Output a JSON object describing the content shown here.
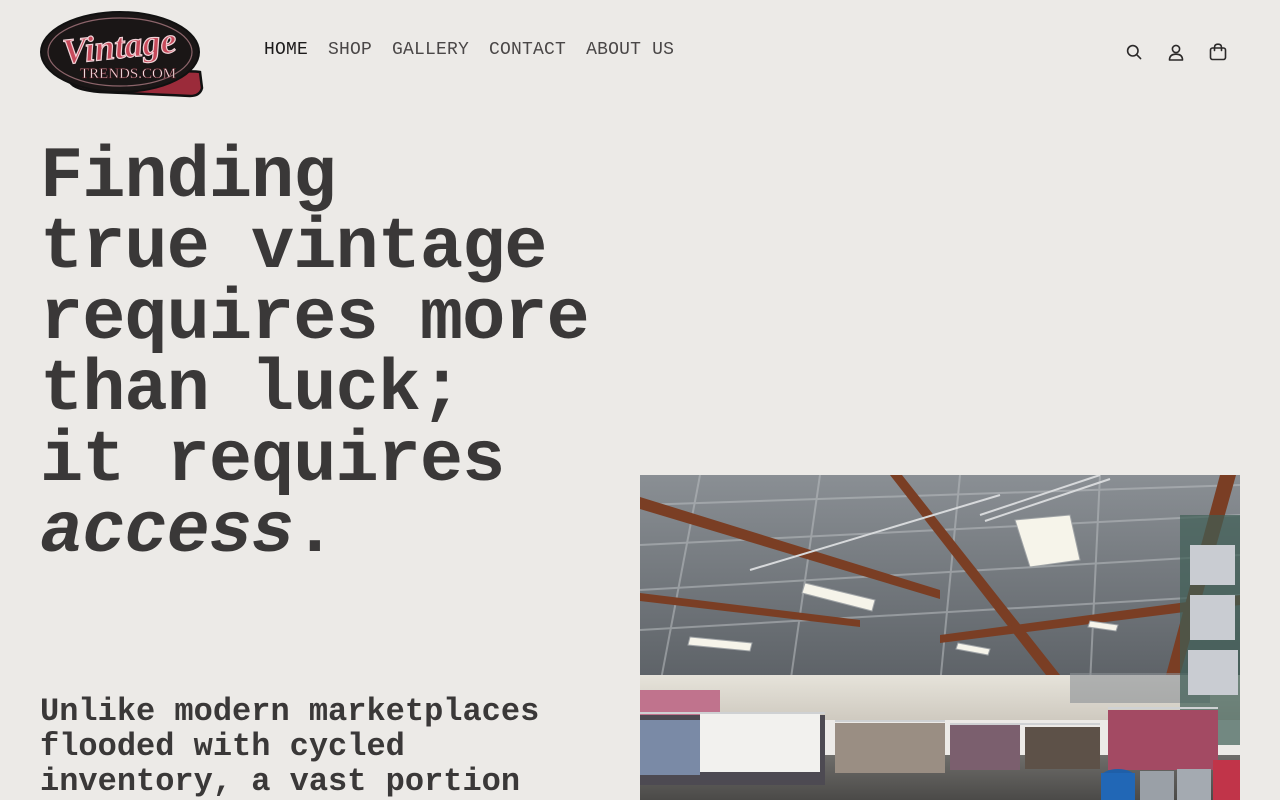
{
  "logo": {
    "script_text": "Vintage",
    "sub_text": "TRENDS.COM"
  },
  "nav": {
    "items": [
      {
        "label": "HOME",
        "active": true
      },
      {
        "label": "SHOP",
        "active": false
      },
      {
        "label": "GALLERY",
        "active": false
      },
      {
        "label": "CONTACT",
        "active": false
      },
      {
        "label": "ABOUT US",
        "active": false
      }
    ]
  },
  "header_icons": [
    "search-icon",
    "account-icon",
    "cart-icon"
  ],
  "hero": {
    "line1": "Finding",
    "line2": "true vintage",
    "line3": "requires more",
    "line4": "than luck;",
    "line5": "it requires",
    "line6_italic": "access",
    "line6_end": ".",
    "subtext": "Unlike modern marketplaces flooded with cycled inventory, a vast portion"
  },
  "colors": {
    "background": "#eceae7",
    "text": "#3a3838",
    "logo_red": "#9b2b3a",
    "logo_black": "#111111"
  }
}
